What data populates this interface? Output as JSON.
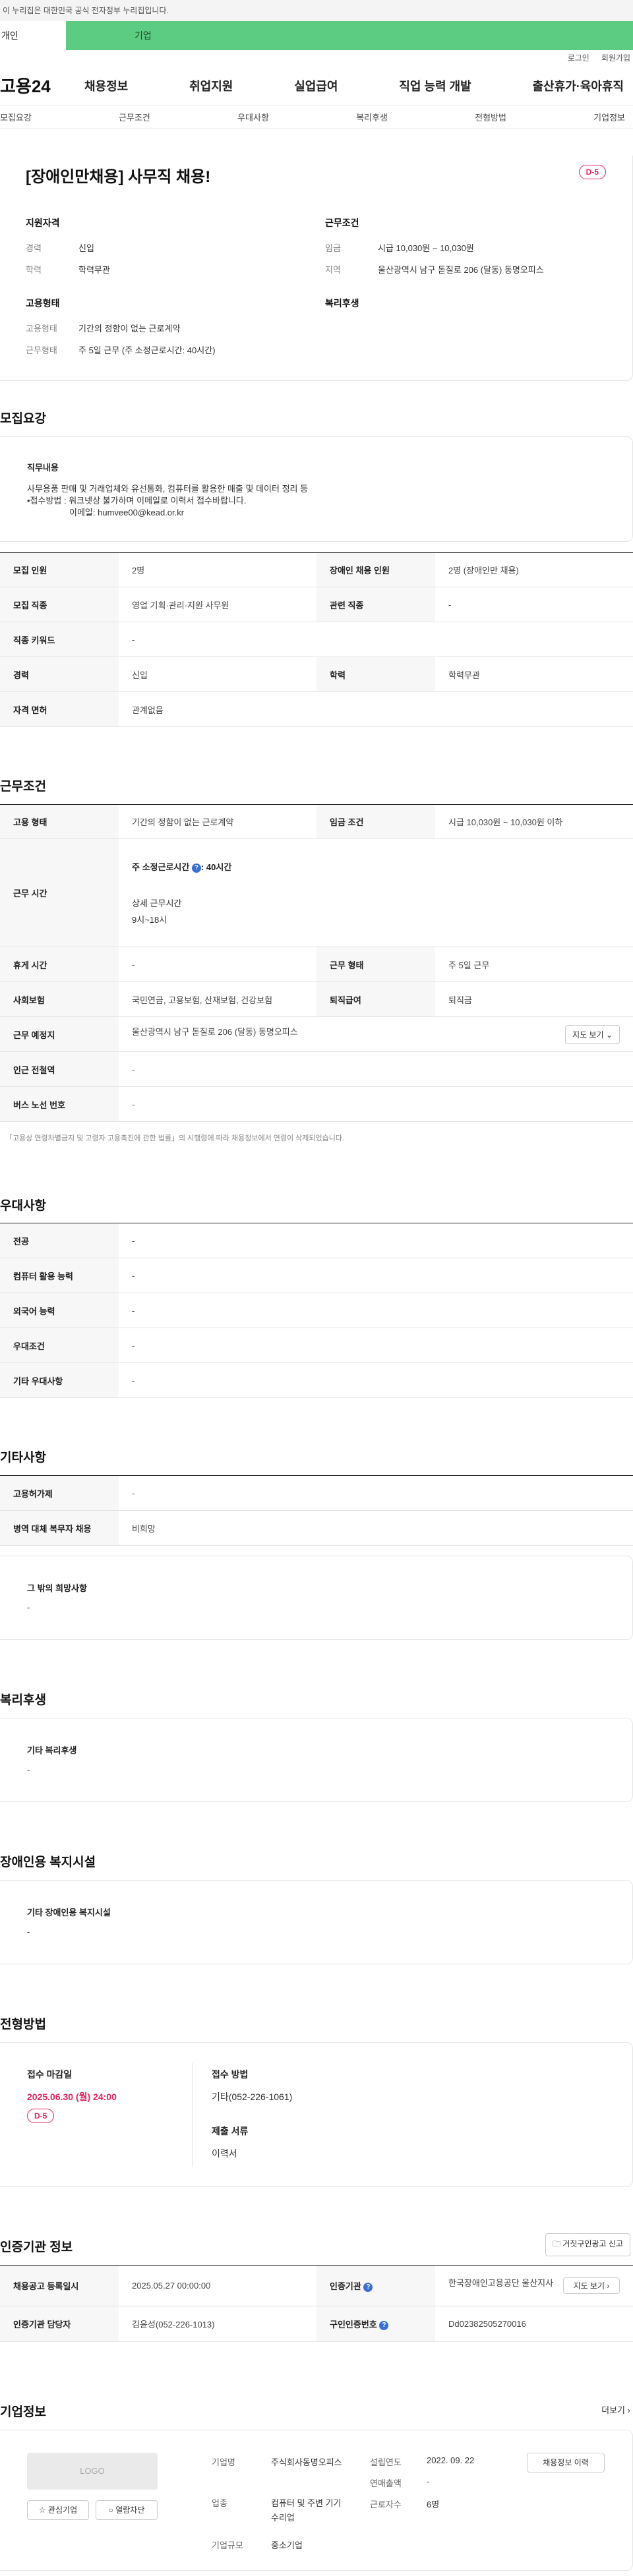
{
  "gov_banner": "이 누리집은 대한민국 공식 전자정부 누리집입니다.",
  "tabs": {
    "personal": "개인",
    "company": "기업"
  },
  "util": {
    "login": "로그인",
    "signup": "회원가입"
  },
  "gnb": {
    "logo": "고용24",
    "menu": [
      "채용정보",
      "취업지원",
      "실업급여",
      "직업 능력 개발",
      "출산휴가·육아휴직"
    ]
  },
  "anchor_nav": [
    "모집요강",
    "근무조건",
    "우대사항",
    "복리후생",
    "전형방법",
    "기업정보"
  ],
  "summary": {
    "title": "[장애인만채용] 사무직 채용!",
    "dday": "D-5",
    "qual_h": "지원자격",
    "career_k": "경력",
    "career_v": "신입",
    "edu_k": "학력",
    "edu_v": "학력무관",
    "cond_h": "근무조건",
    "wage_k": "임금",
    "wage_v": "시급 10,030원 ~ 10,030원",
    "region_k": "지역",
    "region_v": "울산광역시 남구 돋질로 206 (달동) 동명오피스",
    "emp_h": "고용형태",
    "emptype_k": "고용형태",
    "emptype_v": "기간의 정함이 없는 근로계약",
    "worktype_k": "근무형태",
    "worktype_v": "주 5일 근무 (주 소정근로시간: 40시간)",
    "welfare_h": "복리후생"
  },
  "recruit": {
    "heading": "모집요강",
    "duty_h": "직무내용",
    "duty_lines": [
      "사무용품 판매 및 거래업체와 유선통화, 컴퓨터를 활용한 매출 및 데이터 정리 등",
      "•접수방법 : 워크넷상 불가하며 이메일로 이력서 접수바랍니다.",
      "이메일: humvee00@kead.or.kr"
    ],
    "rows": [
      {
        "k1": "모집 인원",
        "v1": "2명",
        "k2": "장애인 채용 인원",
        "v2": "2명 (장애인만 채용)"
      },
      {
        "k1": "모집 직종",
        "v1": "영업 기획·관리·지원 사무원",
        "k2": "관련 직종",
        "v2": "-"
      },
      {
        "k1": "직종 키워드",
        "v1": "-"
      },
      {
        "k1": "경력",
        "v1": "신입",
        "k2": "학력",
        "v2": "학력무관"
      },
      {
        "k1": "자격 면허",
        "v1": "관계없음"
      }
    ]
  },
  "work": {
    "heading": "근무조건",
    "emp_k": "고용 형태",
    "emp_v": "기간의 정함이 없는 근로계약",
    "wage_k": "임금 조건",
    "wage_v": "시급 10,030원 ~ 10,030원 이하",
    "time_k": "근무 시간",
    "time_week": "주 소정근로시간",
    "time_week_v": ": 40시간",
    "time_detail_h": "상세 근무시간",
    "time_detail_v": "9시~18시",
    "break_k": "휴게 시간",
    "break_v": "-",
    "form_k": "근무 형태",
    "form_v": "주 5일 근무",
    "ins_k": "사회보험",
    "ins_v": "국민연금, 고용보험, 산재보험, 건강보험",
    "sev_k": "퇴직급여",
    "sev_v": "퇴직금",
    "place_k": "근무 예정지",
    "place_v": "울산광역시 남구 돋질로 206 (달동) 동명오피스",
    "map_btn": "지도 보기",
    "subway_k": "인근 전철역",
    "subway_v": "-",
    "bus_k": "버스 노선 번호",
    "bus_v": "-",
    "note": "「고용상 연령차별금지 및 고령자 고용촉진에 관한 법률」의 시행령에 따라 채용정보에서 연령이 삭제되었습니다."
  },
  "pref": {
    "heading": "우대사항",
    "rows": [
      {
        "k": "전공",
        "v": "-"
      },
      {
        "k": "컴퓨터 활용 능력",
        "v": "-"
      },
      {
        "k": "외국어 능력",
        "v": "-"
      },
      {
        "k": "우대조건",
        "v": "-"
      },
      {
        "k": "기타 우대사항",
        "v": "-"
      }
    ]
  },
  "etc": {
    "heading": "기타사항",
    "rows": [
      {
        "k": "고용허가제",
        "v": "-"
      },
      {
        "k": "병역 대체 복무자 채용",
        "v": "비희망"
      }
    ],
    "wish_h": "그 밖의 희망사항",
    "wish_v": "-"
  },
  "welfare": {
    "heading": "복리후생",
    "h": "기타 복리후생",
    "v": "-"
  },
  "disab": {
    "heading": "장애인용 복지시설",
    "h": "기타 장애인용 복지시설",
    "v": "-"
  },
  "screen": {
    "heading": "전형방법",
    "deadline_h": "접수 마감일",
    "deadline_v": "2025.06.30 (월) 24:00",
    "dday": "D-5",
    "method_h": "접수 방법",
    "method_v": "기타(052-226-1061)",
    "docs_h": "제출 서류",
    "docs_v": "이력서"
  },
  "cert": {
    "heading": "인증기관 정보",
    "report_btn": "거짓구인광고 신고",
    "reg_k": "채용공고 등록일시",
    "reg_v": "2025.05.27 00:00:00",
    "agency_k": "인증기관",
    "agency_v": "한국장애인고용공단 울산지사",
    "map_btn": "지도 보기",
    "manager_k": "인증기관 담당자",
    "manager_v": "김윤성(052-226-1013)",
    "certno_k": "구인인증번호",
    "certno_v": "Dd02382505270016"
  },
  "company": {
    "heading": "기업정보",
    "more": "더보기",
    "logo": "LOGO",
    "fav_btn": "관심기업",
    "block_btn": "열람차단",
    "name_k": "기업명",
    "name_v": "주식회사동명오피스",
    "industry_k": "업종",
    "industry_v": "컴퓨터 및 주변 기기 수리업",
    "size_k": "기업규모",
    "size_v": "중소기업",
    "est_k": "설립연도",
    "est_v": "2022. 09. 22",
    "sales_k": "연매출액",
    "sales_v": "-",
    "staff_k": "근로자수",
    "staff_v": "6명",
    "history_btn": "채용정보 이력"
  }
}
